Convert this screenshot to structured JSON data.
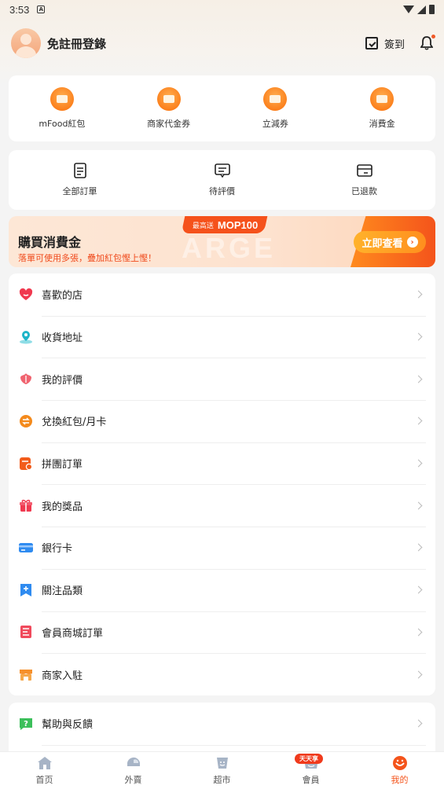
{
  "status_bar": {
    "time": "3:53",
    "notif_letter": "A"
  },
  "header": {
    "login_text": "免註冊登錄",
    "checkin_label": "簽到"
  },
  "quick_actions": [
    {
      "label": "mFood紅包",
      "icon": "red-packet-icon"
    },
    {
      "label": "商家代金券",
      "icon": "voucher-icon"
    },
    {
      "label": "立減券",
      "icon": "discount-coupon-icon"
    },
    {
      "label": "消費金",
      "icon": "wallet-icon"
    }
  ],
  "orders": [
    {
      "label": "全部訂單",
      "icon": "order-list-icon"
    },
    {
      "label": "待評價",
      "icon": "comment-icon"
    },
    {
      "label": "已退款",
      "icon": "refund-icon"
    }
  ],
  "banner": {
    "title": "購買消費金",
    "subtitle": "落單可使用多張，疊加紅包慳上慳！",
    "badge_small": "最高送",
    "badge_big": "MOP100",
    "watermark": "ARGE",
    "cta": "立即查看"
  },
  "menu": [
    {
      "label": "喜歡的店",
      "icon": "heart-icon",
      "color": "#f0394f"
    },
    {
      "label": "收貨地址",
      "icon": "location-icon",
      "color": "#1fb5c8"
    },
    {
      "label": "我的評價",
      "icon": "review-flower-icon",
      "color": "#f0636f"
    },
    {
      "label": "兌換紅包/月卡",
      "icon": "exchange-icon",
      "color": "#f48a1c"
    },
    {
      "label": "拼團訂單",
      "icon": "group-order-icon",
      "color": "#f25c1b"
    },
    {
      "label": "我的獎品",
      "icon": "gift-icon",
      "color": "#f0394f"
    },
    {
      "label": "銀行卡",
      "icon": "bank-card-icon",
      "color": "#2f8bf0"
    },
    {
      "label": "關注品類",
      "icon": "follow-category-icon",
      "color": "#2f8bf0"
    },
    {
      "label": "會員商城訂單",
      "icon": "mall-order-icon",
      "color": "#f04a5c"
    },
    {
      "label": "商家入駐",
      "icon": "shop-icon",
      "color": "#f6902b"
    }
  ],
  "menu2": [
    {
      "label": "幫助與反饋",
      "icon": "help-icon",
      "color": "#3bbf5a"
    }
  ],
  "bottom_nav": [
    {
      "label": "首页",
      "icon": "home-icon",
      "active": false
    },
    {
      "label": "外賣",
      "icon": "delivery-helmet-icon",
      "active": false
    },
    {
      "label": "超市",
      "icon": "supermarket-icon",
      "active": false
    },
    {
      "label": "會員",
      "icon": "member-icon",
      "active": false,
      "badge": "天天享"
    },
    {
      "label": "我的",
      "icon": "profile-icon",
      "active": true
    }
  ],
  "colors": {
    "accent": "#f4541b",
    "brand_orange": "#fb7a16"
  }
}
